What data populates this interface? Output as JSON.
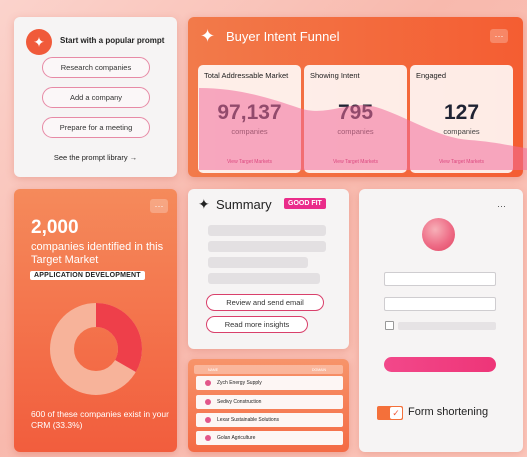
{
  "prompts": {
    "heading": "Start with a popular prompt",
    "items": [
      "Research companies",
      "Add a company",
      "Prepare for a meeting"
    ],
    "link": "See the prompt library →"
  },
  "funnel": {
    "title": "Buyer Intent Funnel",
    "more": "···",
    "panels": [
      {
        "label": "Total Addressable Market",
        "value": "97,137",
        "unit": "companies",
        "link": "View Target Markets"
      },
      {
        "label": "Showing Intent",
        "value": "795",
        "unit": "companies",
        "link": "View Target Markets"
      },
      {
        "label": "Engaged",
        "value": "127",
        "unit": "companies",
        "link": "View Target Markets"
      }
    ]
  },
  "market": {
    "more": "···",
    "count": "2,000",
    "description": "companies identified in this Target Market",
    "badge": "APPLICATION DEVELOPMENT",
    "footnote": "600 of these companies exist in your CRM (33.3%)",
    "donut_fraction": 0.333
  },
  "summary": {
    "title": "Summary",
    "badge": "GOOD FIT",
    "actions": [
      "Review and send email",
      "Read more insights"
    ]
  },
  "table": {
    "columns": [
      "NAME",
      "DOMAIN"
    ],
    "rows": [
      "Zych Energy Supply",
      "Sedivy Construction",
      "Lexar Sustainable Solutions",
      "Golan Agriculture"
    ]
  },
  "form": {
    "more": "···",
    "toggle_label": "Form shortening",
    "toggle_on": true
  },
  "colors": {
    "accent": "#f25d3d",
    "pink": "#ea2c8a"
  }
}
